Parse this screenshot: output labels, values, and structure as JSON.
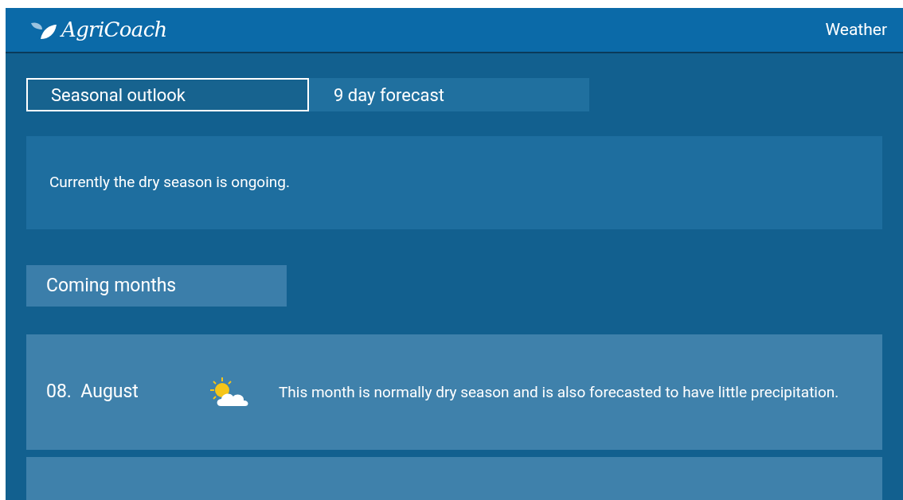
{
  "header": {
    "app_name": "AgriCoach",
    "page_title": "Weather"
  },
  "tabs": [
    {
      "label": "Seasonal outlook",
      "selected": true
    },
    {
      "label": "9 day forecast",
      "selected": false
    }
  ],
  "status": {
    "text": "Currently the dry season is ongoing."
  },
  "section_title": "Coming months",
  "months": [
    {
      "number": "08.",
      "name": "August",
      "kind": "partly_sunny",
      "description": "This month is normally dry season and is also forecasted to have little precipitation."
    },
    {
      "kind": "cut"
    }
  ]
}
